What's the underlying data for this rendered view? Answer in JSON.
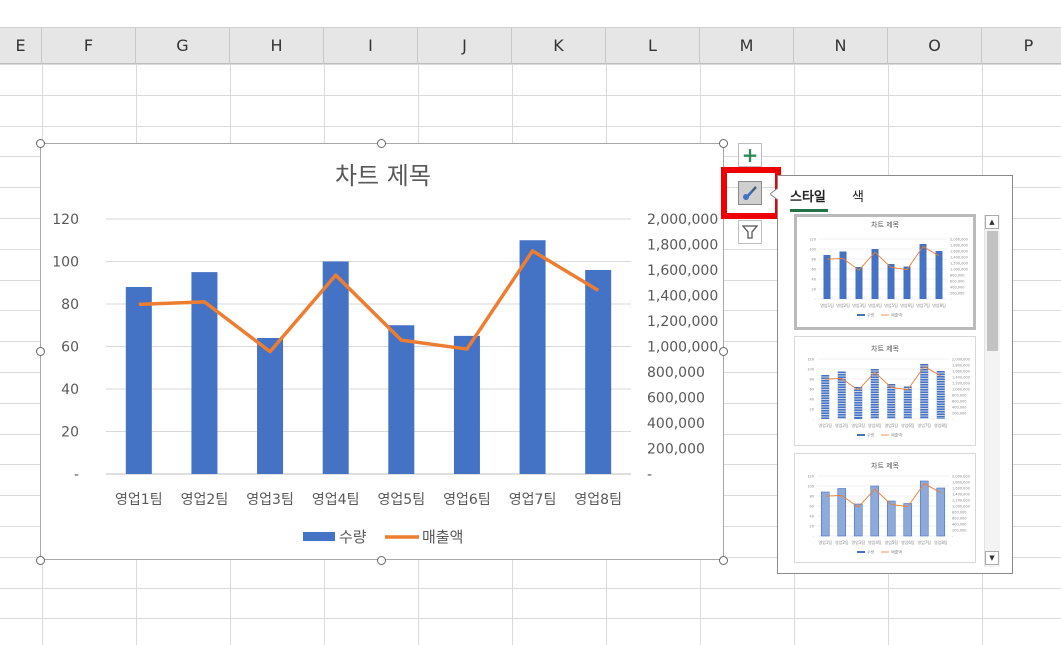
{
  "columns": [
    "E",
    "F",
    "G",
    "H",
    "I",
    "J",
    "K",
    "L",
    "M",
    "N",
    "O",
    "P"
  ],
  "chart": {
    "title": "차트 제목",
    "categories": [
      "영업1팀",
      "영업2팀",
      "영업3팀",
      "영업4팀",
      "영업5팀",
      "영업6팀",
      "영업7팀",
      "영업8팀"
    ],
    "left_ticks": [
      "120",
      "100",
      "80",
      "60",
      "40",
      "20",
      "-"
    ],
    "right_ticks": [
      "2,000,000",
      "1,800,000",
      "1,600,000",
      "1,400,000",
      "1,200,000",
      "1,000,000",
      "800,000",
      "600,000",
      "400,000",
      "200,000",
      "-"
    ],
    "legend": {
      "bar_label": "수량",
      "line_label": "매출액"
    },
    "colors": {
      "bar": "#4472c4",
      "line": "#ed7d31"
    }
  },
  "chart_data": {
    "type": "bar",
    "title": "차트 제목",
    "categories": [
      "영업1팀",
      "영업2팀",
      "영업3팀",
      "영업4팀",
      "영업5팀",
      "영업6팀",
      "영업7팀",
      "영업8팀"
    ],
    "series": [
      {
        "name": "수량",
        "type": "bar",
        "axis": "left",
        "values": [
          88,
          95,
          64,
          100,
          70,
          65,
          110,
          96
        ]
      },
      {
        "name": "매출액",
        "type": "line",
        "axis": "right",
        "values": [
          1330000,
          1350000,
          960000,
          1560000,
          1050000,
          980000,
          1750000,
          1440000
        ]
      }
    ],
    "ylim": [
      0,
      120
    ],
    "y2lim": [
      0,
      2000000
    ],
    "legend": "bottom",
    "grid": true
  },
  "pane": {
    "tabs": [
      "스타일",
      "색"
    ],
    "thumb_title": "차트 제목",
    "thumb_legend": [
      "수량",
      "매출액"
    ]
  },
  "buttons": {
    "elements": "+",
    "styles": "paintbrush",
    "filter": "filter"
  }
}
